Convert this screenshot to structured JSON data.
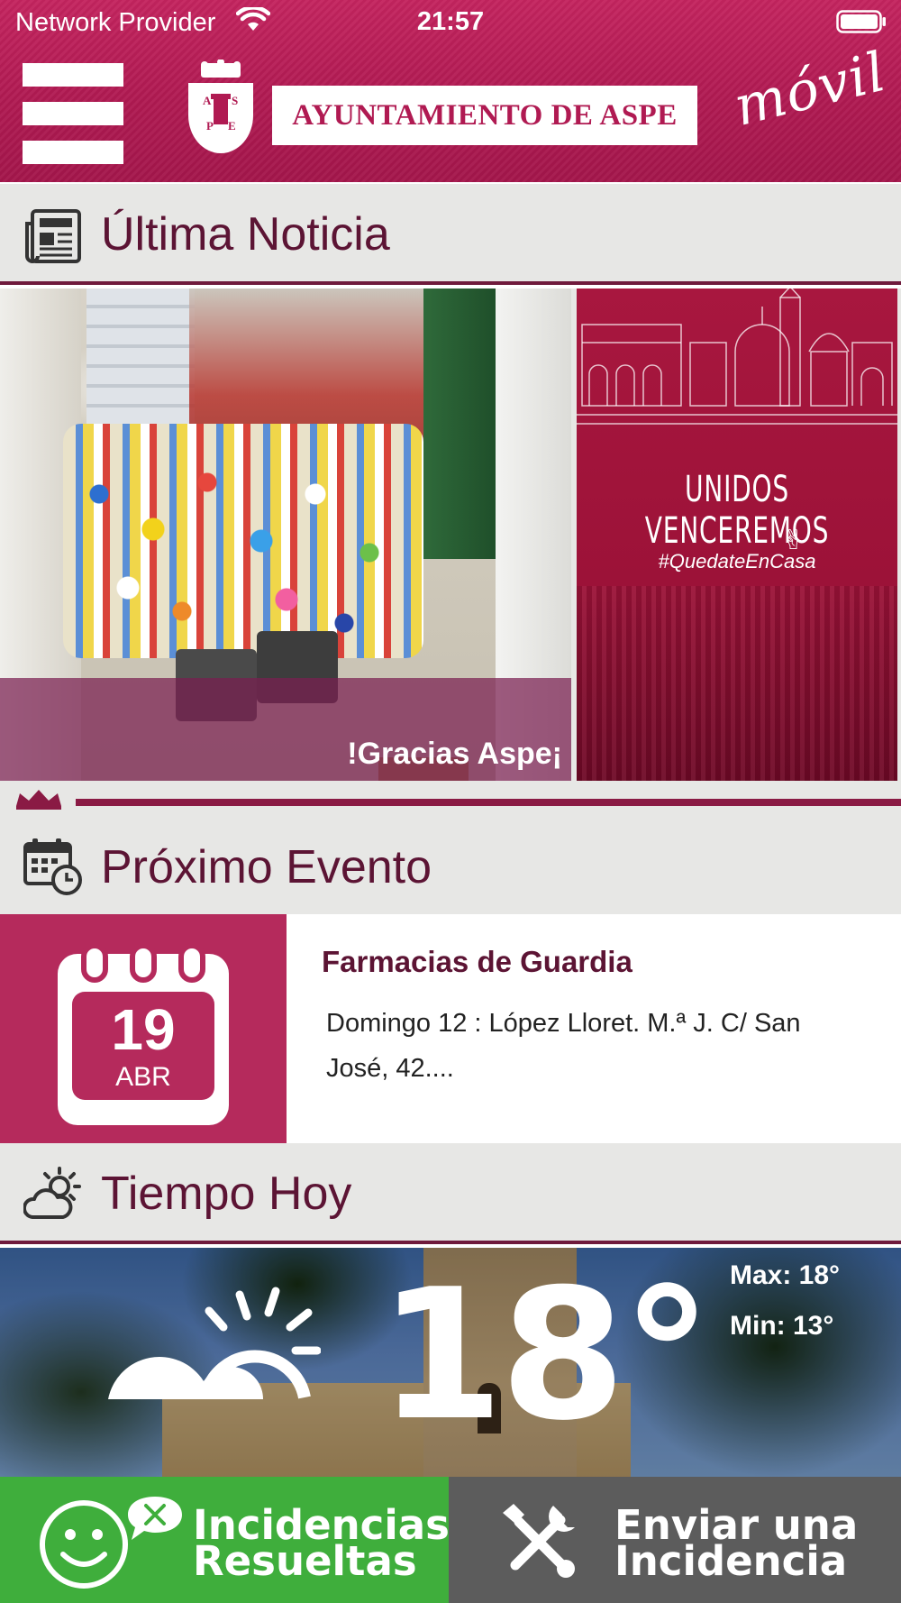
{
  "status_bar": {
    "carrier": "Network Provider",
    "time": "21:57"
  },
  "header": {
    "brand": "AYUNTAMIENTO DE ASPE",
    "tagline": "móvil",
    "crest_letters": [
      "A",
      "S",
      "P",
      "E"
    ]
  },
  "sections": {
    "news": {
      "title": "Última Noticia",
      "icon": "newspaper-icon"
    },
    "event": {
      "title": "Próximo Evento",
      "icon": "calendar-clock-icon"
    },
    "weather": {
      "title": "Tiempo Hoy",
      "icon": "partly-cloudy-icon"
    }
  },
  "news": {
    "caption": "!Gracias Aspe¡",
    "next_slide": {
      "heading": "UNIDOS VENCEREMOS",
      "hashtag": "#QuedateEnCasa"
    }
  },
  "event": {
    "day": "19",
    "month": "ABR",
    "title": "Farmacias de Guardia",
    "description": "Domingo 12 : López Lloret. M.ª J. C/ San José, 42...."
  },
  "weather": {
    "temperature": "18°",
    "max": "Max: 18°",
    "min": "Min: 13°",
    "condition_icon": "sun-behind-cloud-icon"
  },
  "footer": {
    "resueltas": {
      "line1": "Incidencias",
      "line2": "Resueltas",
      "color": "#3fae3c"
    },
    "enviar": {
      "line1": "Enviar una",
      "line2": "Incidencia",
      "color": "#5c5c5c"
    }
  },
  "colors": {
    "brand": "#b01a52",
    "heading_text": "#5c1434",
    "section_bg": "#e7e7e5"
  }
}
